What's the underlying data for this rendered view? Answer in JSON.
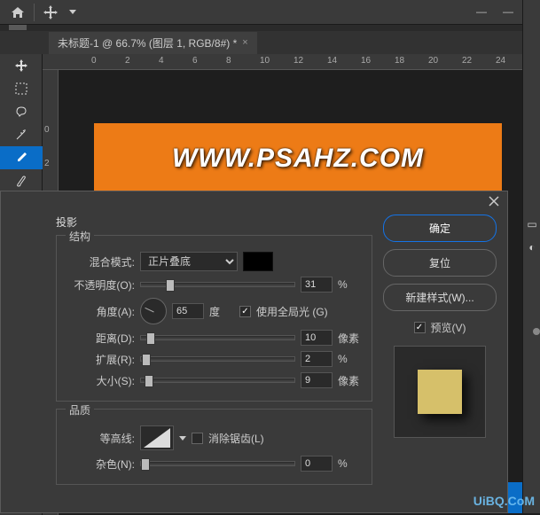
{
  "topbar": {
    "home": "",
    "move": ""
  },
  "win": {
    "min": "—",
    "max": "□",
    "close": "—"
  },
  "tab": {
    "title": "未标题-1 @ 66.7% (图层 1, RGB/8#) *",
    "close": "×"
  },
  "ruler_h": [
    "0",
    "2",
    "4",
    "6",
    "8",
    "10",
    "12",
    "14",
    "16",
    "18",
    "20",
    "22",
    "24"
  ],
  "ruler_v": [
    "0",
    "2"
  ],
  "canvas": {
    "text": "WWW.PSAHZ.COM"
  },
  "dialog": {
    "section": "投影",
    "group1": "结构",
    "blendmode": {
      "label": "混合模式:",
      "value": "正片叠底",
      "color": "#000000"
    },
    "opacity": {
      "label": "不透明度(O):",
      "value": "31",
      "unit": "%"
    },
    "angle": {
      "label": "角度(A):",
      "value": "65",
      "unit": "度",
      "global_label": "使用全局光 (G)",
      "global": true
    },
    "distance": {
      "label": "距离(D):",
      "value": "10",
      "unit": "像素"
    },
    "spread": {
      "label": "扩展(R):",
      "value": "2",
      "unit": "%"
    },
    "size": {
      "label": "大小(S):",
      "value": "9",
      "unit": "像素"
    },
    "group2": "品质",
    "contour": {
      "label": "等高线:",
      "antialias": "消除锯齿(L)",
      "antialias_on": false
    },
    "noise": {
      "label": "杂色(N):",
      "value": "0",
      "unit": "%"
    },
    "buttons": {
      "ok": "确定",
      "reset": "复位",
      "newstyle": "新建样式(W)...",
      "preview": "预览(V)"
    }
  },
  "watermark": "UiBQ.CoM"
}
